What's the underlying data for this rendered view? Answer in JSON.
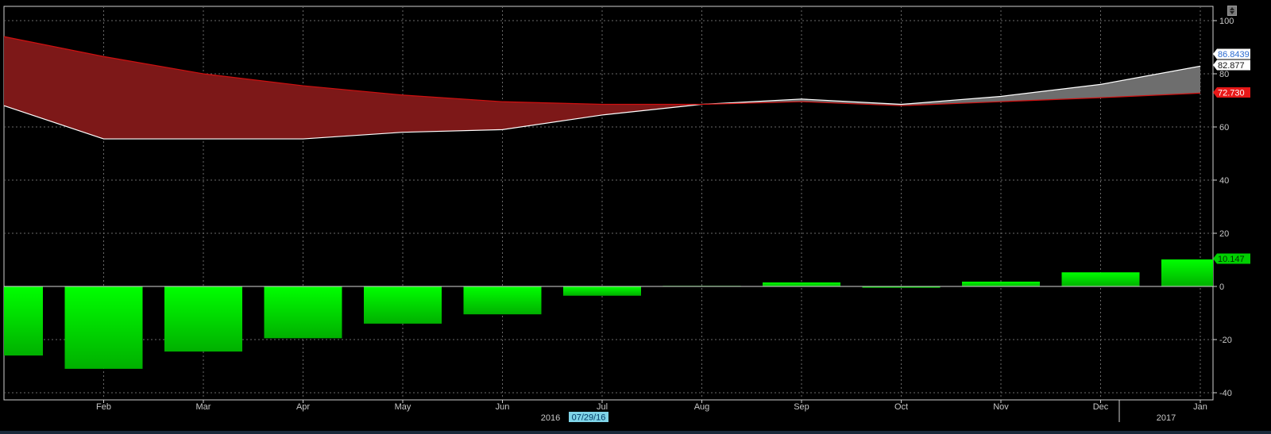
{
  "chart_data": {
    "type": "bar+area",
    "categories": [
      "Jan",
      "Feb",
      "Mar",
      "Apr",
      "May",
      "Jun",
      "Jul",
      "Aug",
      "Sep",
      "Oct",
      "Nov",
      "Dec",
      "Jan"
    ],
    "x_tick_labels": [
      "Feb",
      "Mar",
      "Apr",
      "May",
      "Jun",
      "Jul",
      "Aug",
      "Sep",
      "Oct",
      "Nov",
      "Dec",
      "Jan"
    ],
    "year_labels": [
      "2016",
      "2017"
    ],
    "date_marker": "07/29/16",
    "ylim": [
      -40,
      100
    ],
    "y_ticks": [
      100,
      80,
      60,
      40,
      20,
      0,
      -20,
      -40
    ],
    "y_tick_labels": [
      "100",
      "80",
      "60",
      "40",
      "20",
      "0",
      "-20",
      "-40"
    ],
    "grid": true,
    "series": [
      {
        "values": [
          94,
          86.5,
          80,
          75.5,
          72,
          69.5,
          68.5,
          68.5,
          69.5,
          68,
          69.5,
          71,
          72.73
        ],
        "color": "#d01010"
      },
      {
        "values": [
          68,
          55.5,
          55.5,
          55.5,
          58,
          59,
          64.5,
          68.5,
          70.5,
          68.5,
          71.5,
          76,
          82.877
        ],
        "color": "#ffffff"
      },
      {
        "values": [
          -26,
          -31,
          -24.5,
          -19.5,
          -14,
          -10.5,
          -3.5,
          0.2,
          1.5,
          -0.5,
          1.8,
          5.3,
          10.147
        ],
        "color": "#00e600"
      }
    ],
    "last_value_tags": [
      {
        "text": "86.8439",
        "value": 86.8439,
        "bg": "#ffffff",
        "fg": "#2a6ad0"
      },
      {
        "text": "82.877",
        "value": 82.877,
        "bg": "#ffffff",
        "fg": "#111111"
      },
      {
        "text": "72.730",
        "value": 72.73,
        "bg": "#e81818",
        "fg": "#ffffff"
      },
      {
        "text": "10.147",
        "value": 10.147,
        "bg": "#00d000",
        "fg": "#003300"
      }
    ]
  }
}
